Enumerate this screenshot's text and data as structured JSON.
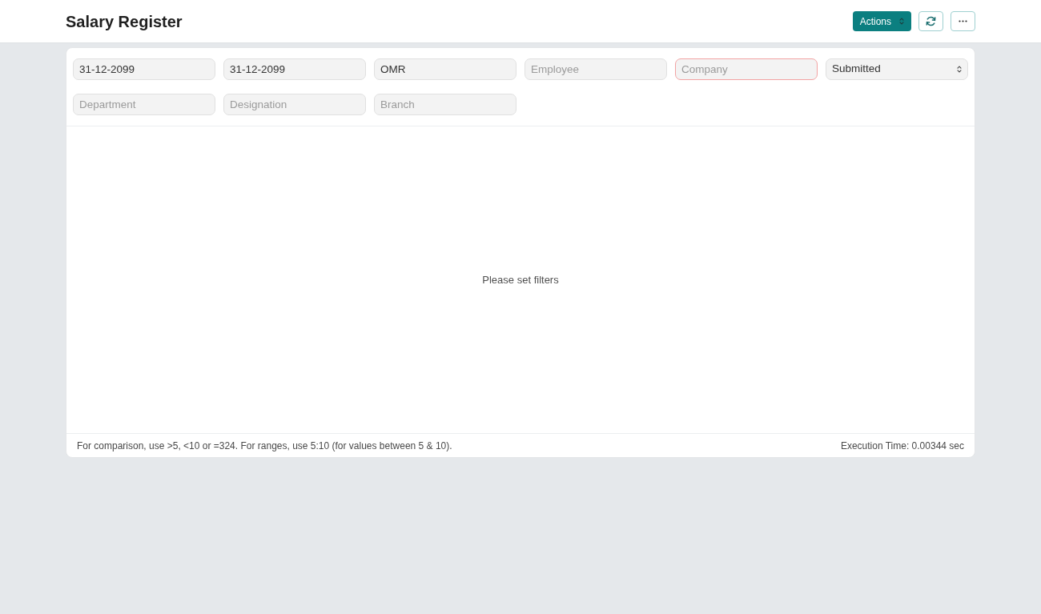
{
  "page": {
    "title": "Salary Register"
  },
  "toolbar": {
    "actions_label": "Actions",
    "icon_buttons": [
      {
        "kind": "refresh"
      },
      {
        "kind": "more"
      }
    ]
  },
  "filters": [
    {
      "kind": "input",
      "value": "31-12-2099",
      "error": false
    },
    {
      "kind": "input",
      "value": "31-12-2099",
      "error": false
    },
    {
      "kind": "input",
      "value": "OMR",
      "error": false
    },
    {
      "kind": "input",
      "placeholder": "Employee",
      "error": false
    },
    {
      "kind": "input",
      "placeholder": "Company",
      "error": true
    },
    {
      "kind": "select",
      "value": "Submitted",
      "error": false
    },
    {
      "kind": "input",
      "placeholder": "Department",
      "error": false
    },
    {
      "kind": "input",
      "placeholder": "Designation",
      "error": false
    },
    {
      "kind": "input",
      "placeholder": "Branch",
      "error": false
    }
  ],
  "empty_message": "Please set filters",
  "footer": {
    "hint": "For comparison, use >5, <10 or =324. For ranges, use 5:10 (for values between 5 & 10).",
    "execution_time": "Execution Time: 0.00344 sec"
  }
}
